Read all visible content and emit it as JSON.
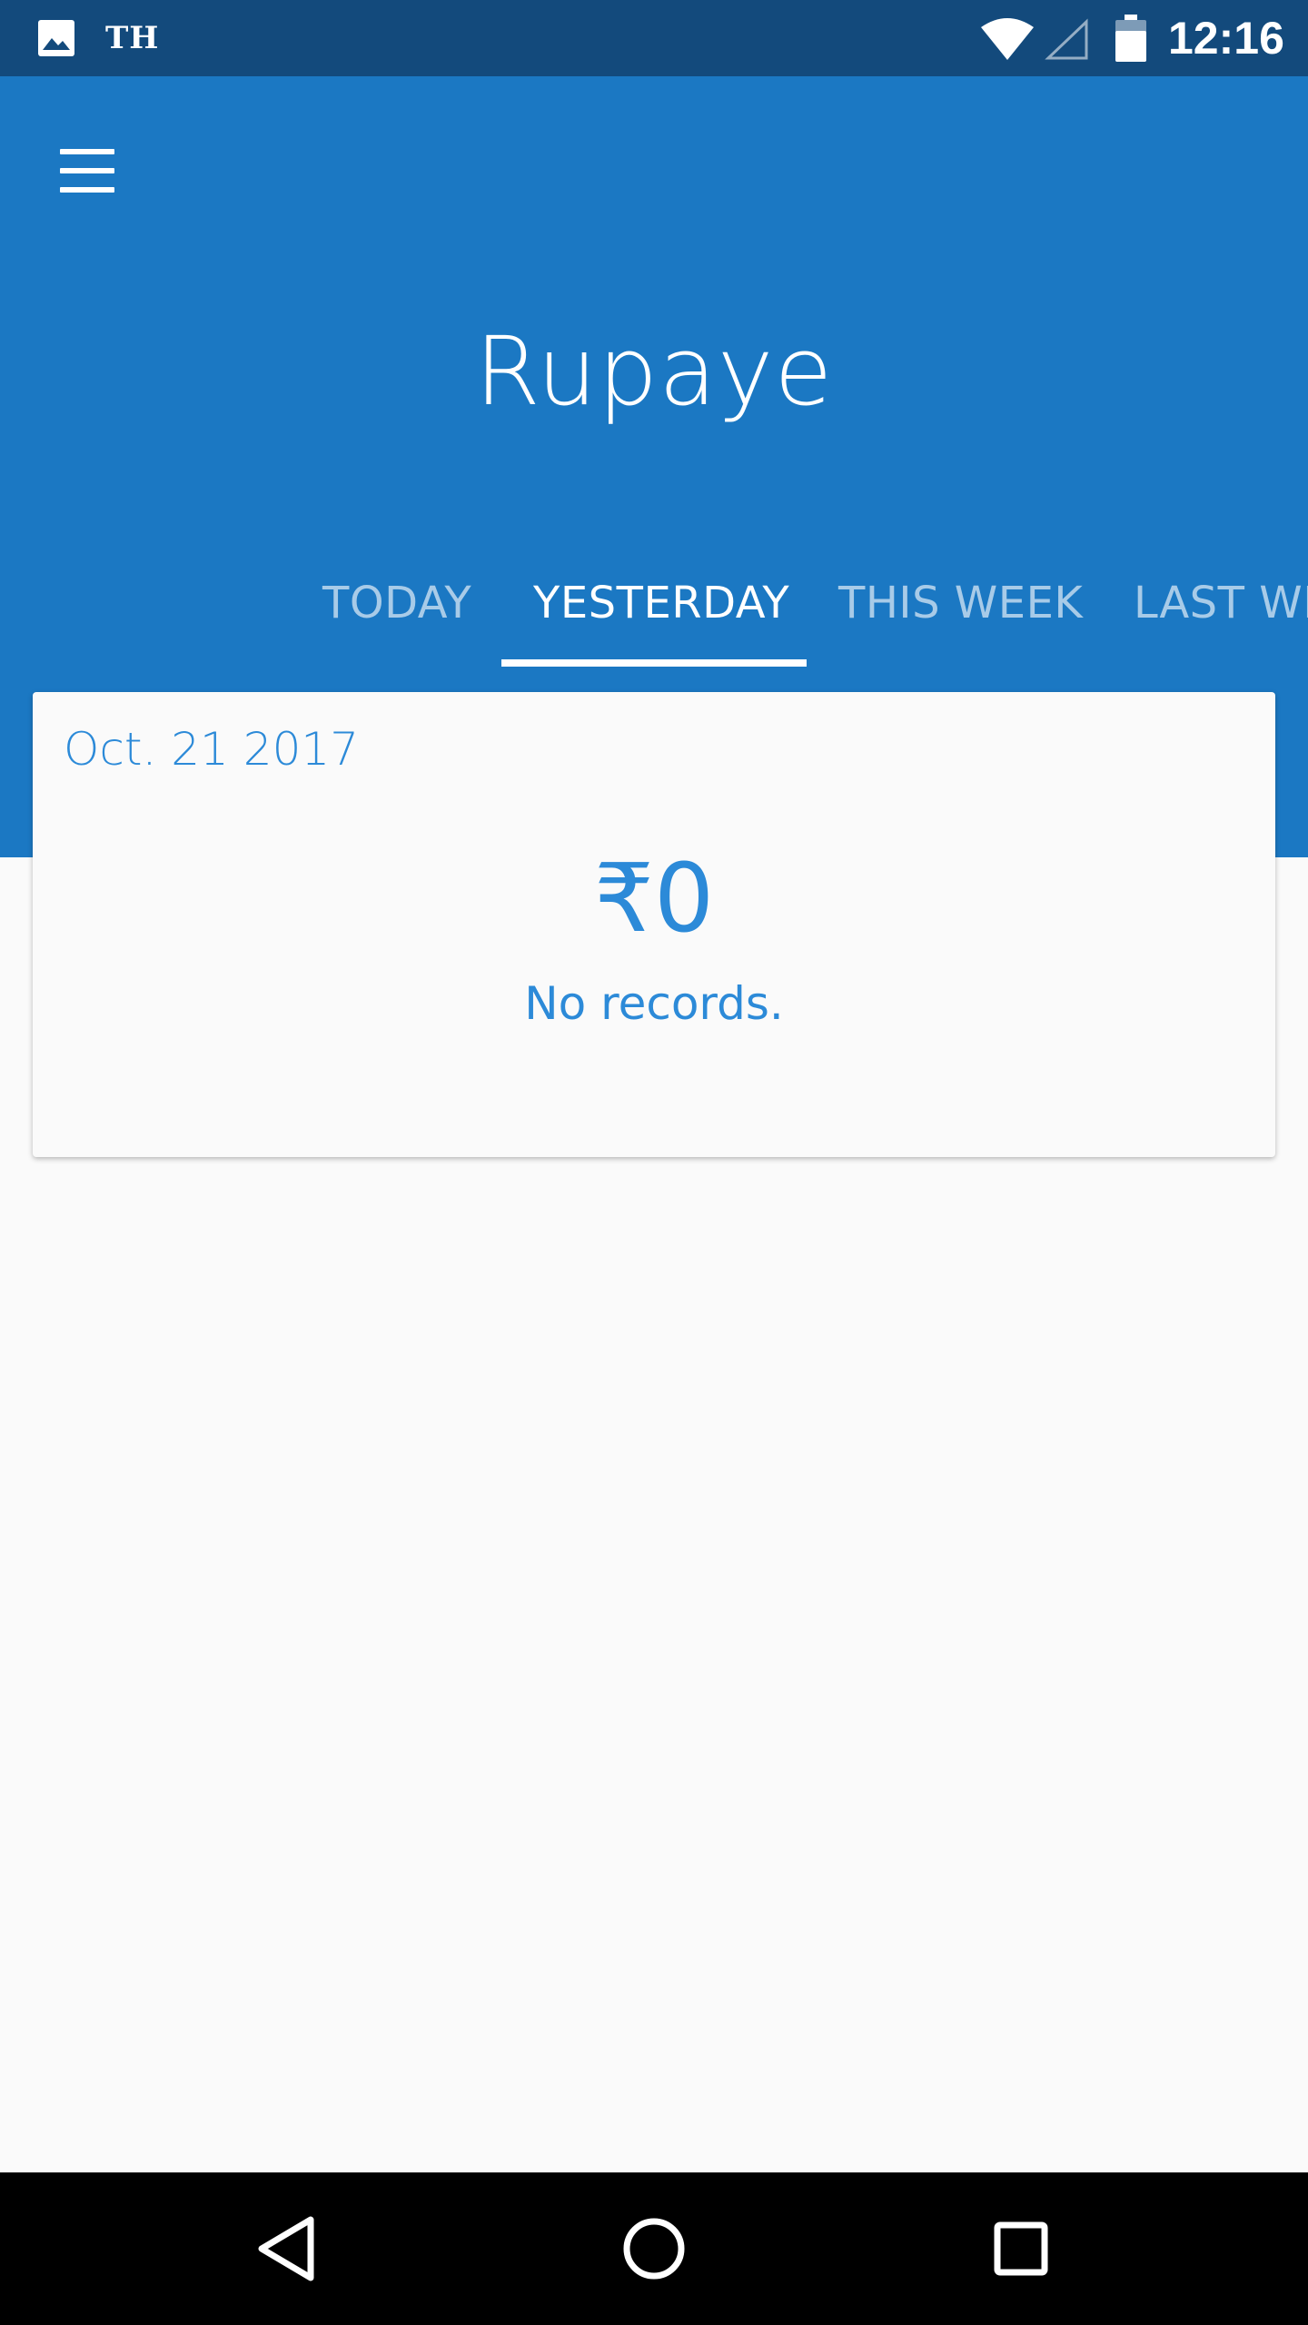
{
  "status_bar": {
    "app_label": "TH",
    "time": "12:16",
    "icons": [
      "gallery-icon",
      "wifi-icon",
      "signal-icon",
      "battery-icon"
    ]
  },
  "header": {
    "menu_icon": "hamburger-menu-icon",
    "title": "Rupaye",
    "tabs": [
      {
        "label": "TODAY",
        "active": false
      },
      {
        "label": "YESTERDAY",
        "active": true
      },
      {
        "label": "THIS WEEK",
        "active": false
      },
      {
        "label": "LAST WE",
        "active": false
      }
    ]
  },
  "card": {
    "date": "Oct. 21 2017",
    "amount": "₹0",
    "message": "No records."
  },
  "nav_bar": {
    "icons": [
      "back-icon",
      "home-icon",
      "recents-icon"
    ]
  },
  "colors": {
    "status_bar": "#134a7c",
    "primary": "#1b78c3",
    "accent_text": "#2c8ad8",
    "background": "#fafafa"
  }
}
